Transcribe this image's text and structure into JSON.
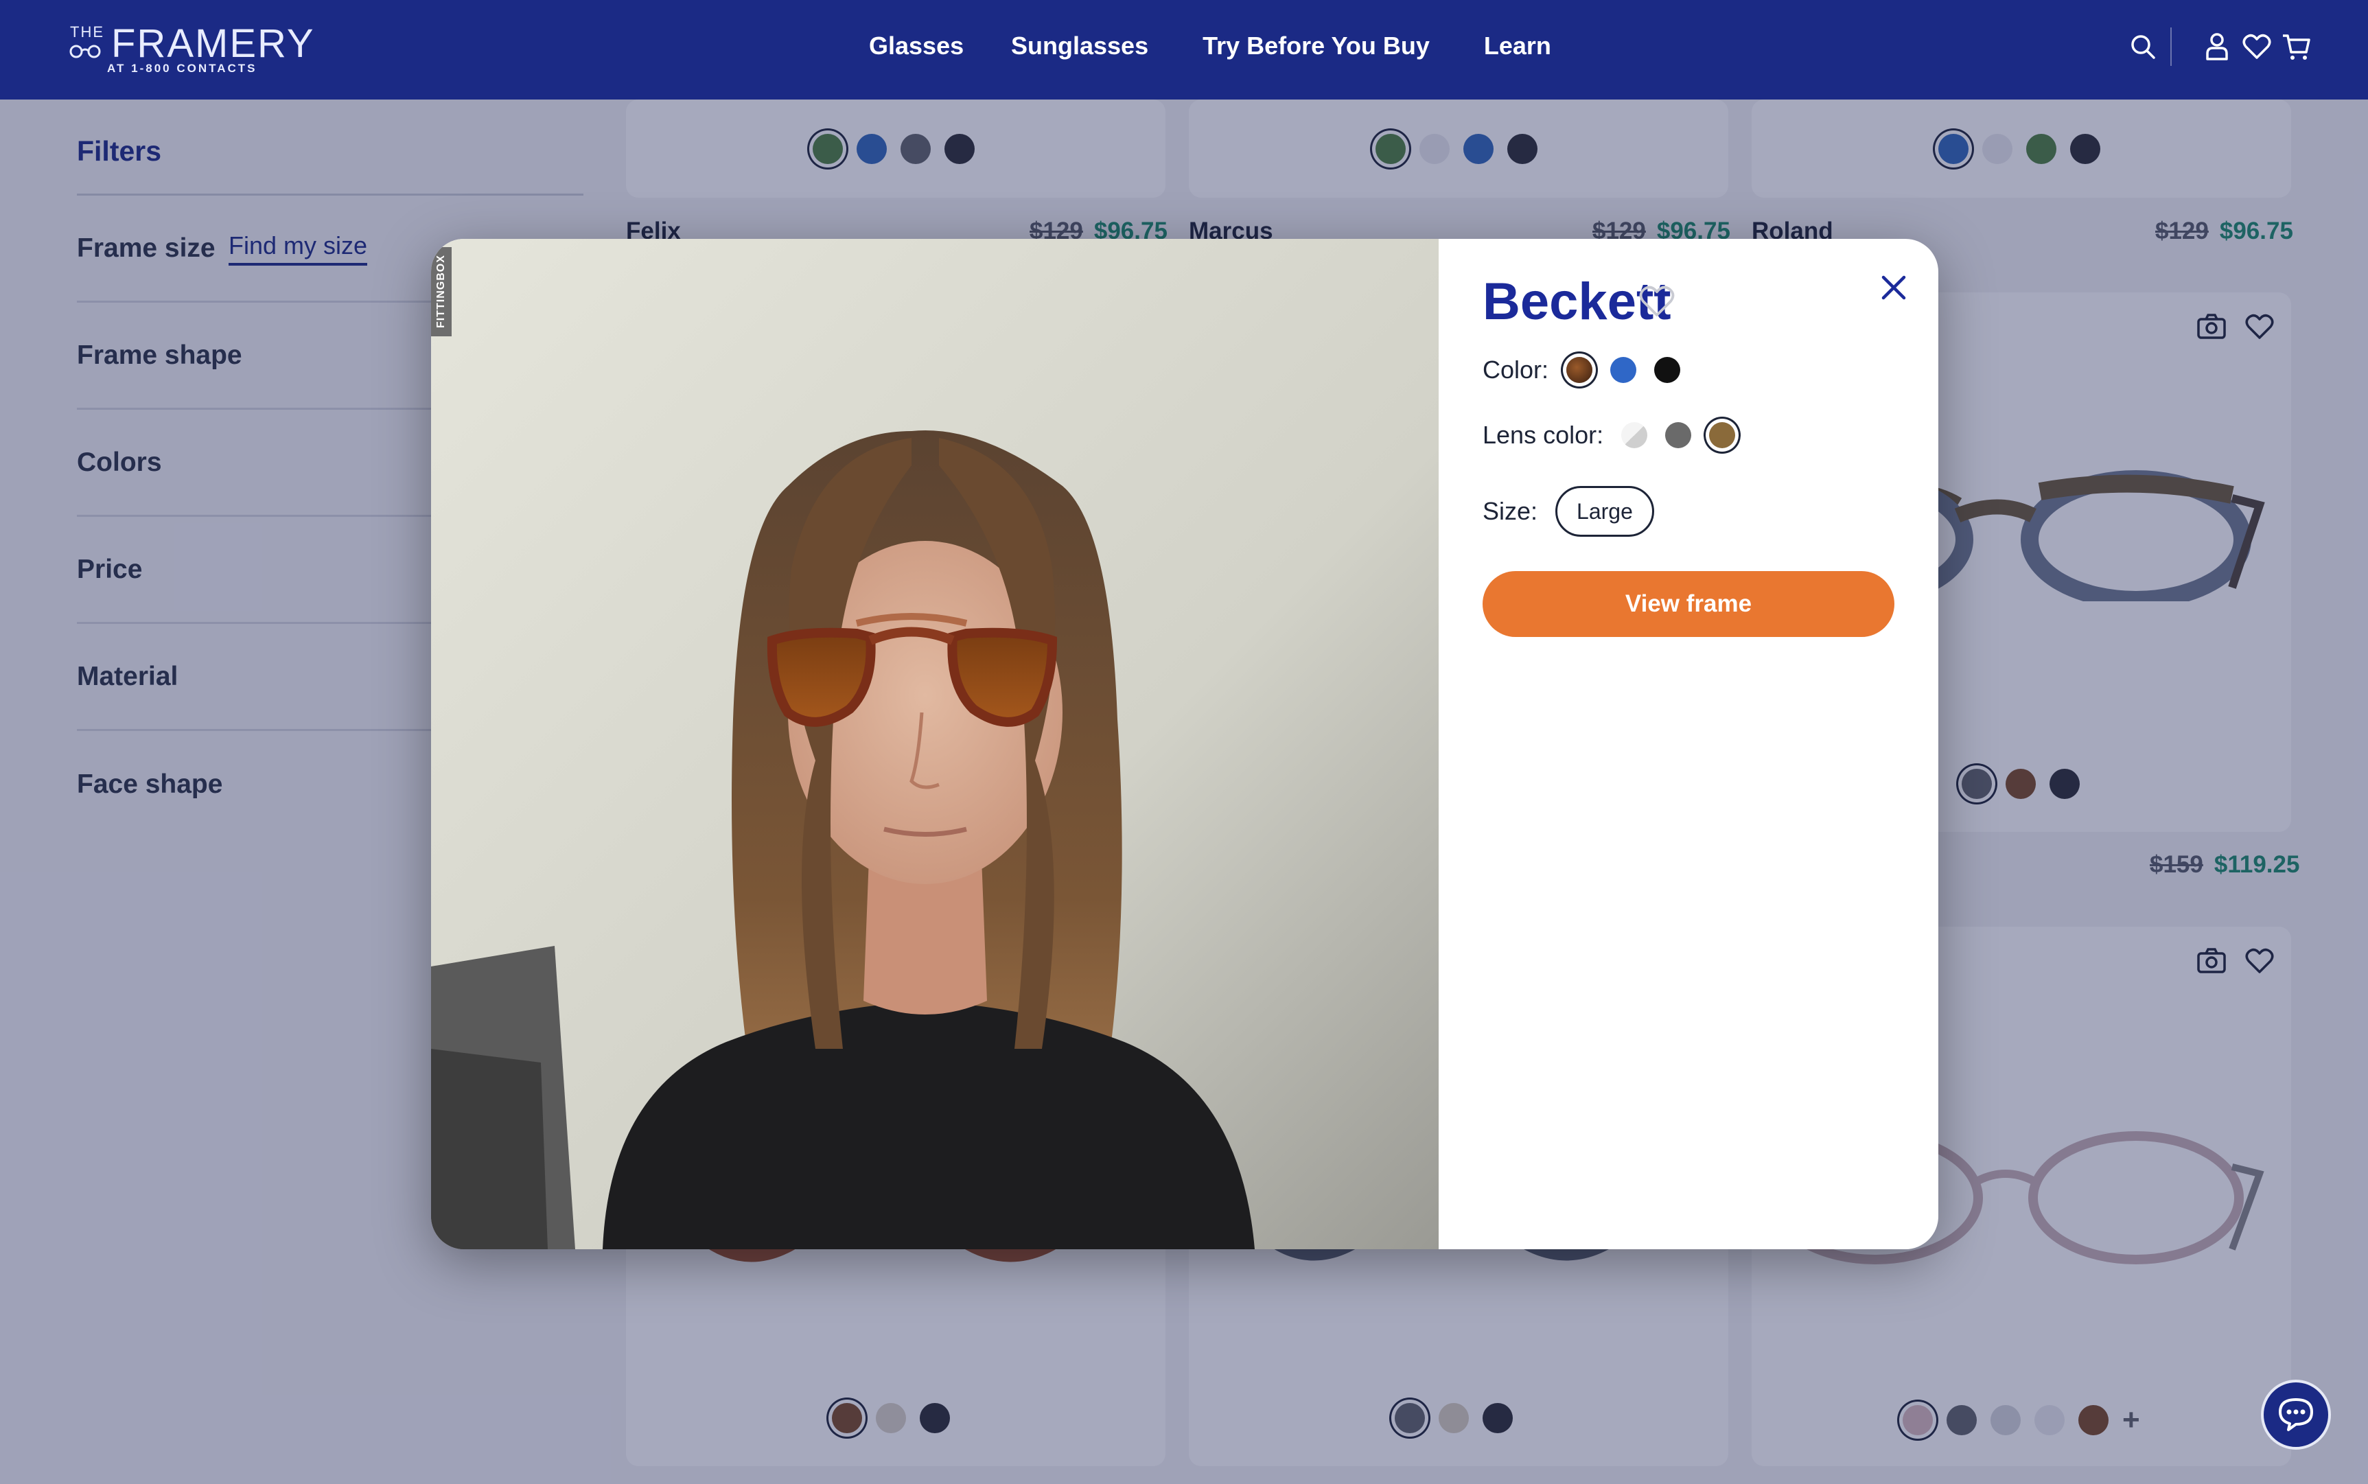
{
  "header": {
    "logo": {
      "top": "THE",
      "brand": "FRAMERY",
      "sub": "AT 1-800 CONTACTS"
    },
    "nav": [
      "Glasses",
      "Sunglasses",
      "Try Before You Buy",
      "Learn"
    ],
    "icons": [
      "search-icon",
      "account-icon",
      "heart-icon",
      "cart-icon"
    ]
  },
  "filters": {
    "title": "Filters",
    "frame_size": "Frame size",
    "find_my_size": "Find my size",
    "items": [
      "Frame shape",
      "Colors",
      "Price",
      "Material",
      "Face shape"
    ]
  },
  "products": [
    {
      "name": "Felix",
      "old_price": "$129",
      "price": "$96.75",
      "swatches": [
        "#4e7f3e",
        "#2f67b8",
        "#5f6368",
        "#2a2c33"
      ],
      "selected": 0
    },
    {
      "name": "Marcus",
      "old_price": "$129",
      "price": "$96.75",
      "swatches": [
        "#4e7f3e",
        "#e9eaee",
        "#2f67b8",
        "#2a2c33"
      ],
      "selected": 0
    },
    {
      "name": "Roland",
      "old_price": "$129",
      "price": "$96.75",
      "swatches": [
        "#2f67b8",
        "#e9eaee",
        "#4e7f3e",
        "#2a2c33"
      ],
      "selected": 0
    }
  ],
  "row2_right": {
    "old_price": "$159",
    "price": "$119.25",
    "swatches": [
      "#5f6368",
      "#7a4a26",
      "#2a2c33"
    ],
    "selected": 0
  },
  "row3": [
    {
      "swatches": [
        "#7a4a26",
        "#d9d2c6",
        "#2a2c33"
      ],
      "selected": 0
    },
    {
      "swatches": [
        "#5f6368",
        "#d8cfbf",
        "#2a2c33"
      ],
      "selected": 0
    },
    {
      "swatches": [
        "#d9b9bd",
        "#5f6368",
        "#d4d6da",
        "#e9eaee",
        "#7a4a26"
      ],
      "selected": 0,
      "more": "+"
    }
  ],
  "modal": {
    "badge": "FITTINGBOX",
    "title": "Beckett",
    "color_label": "Color:",
    "colors": [
      "#6b3b1f",
      "#2f67c7",
      "#111111"
    ],
    "color_selected": 0,
    "lens_label": "Lens color:",
    "lens_colors": [
      "#e6e6e6",
      "#6a6a6a",
      "#8a6a3a"
    ],
    "lens_selected": 2,
    "size_label": "Size:",
    "size_value": "Large",
    "cta": "View frame"
  },
  "colors": {
    "navy": "#1b2a85",
    "cta": "#e97730",
    "sale_green": "#1c8b6a"
  }
}
